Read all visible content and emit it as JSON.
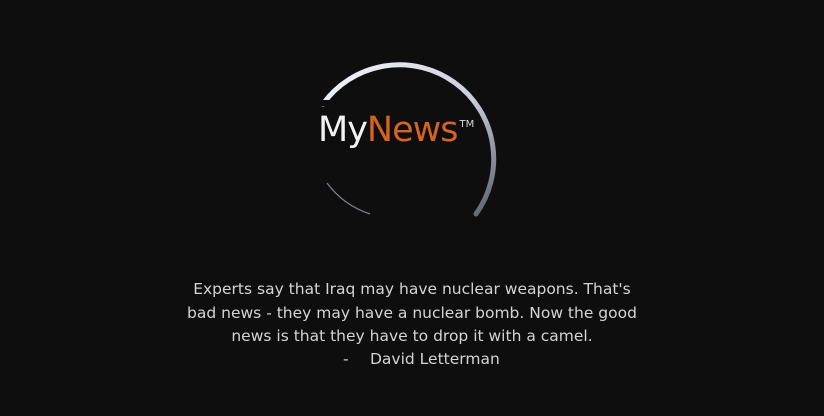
{
  "logo": {
    "my": "My",
    "news": "News",
    "tm": "TM"
  },
  "quote": {
    "lines": [
      "Experts say that Iraq may have nuclear weapons. That's",
      "bad news - they may have a nuclear bomb. Now the good",
      "news is that they have to drop it with a camel."
    ],
    "dash": "-",
    "author": "David Letterman"
  },
  "colors": {
    "background": "#0e0e0f",
    "accent": "#d4641f",
    "ring": "#d9dde6",
    "rule": "#3a6fa8",
    "text": "#d4d4d4"
  }
}
